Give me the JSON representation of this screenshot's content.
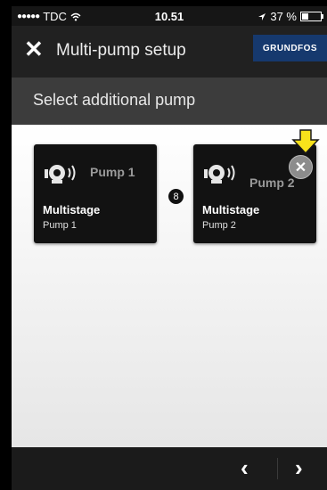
{
  "status": {
    "carrier": "TDC",
    "time": "10.51",
    "battery": "37 %"
  },
  "header": {
    "close_glyph": "✕",
    "title": "Multi-pump setup",
    "logo": "GRUNDFOS"
  },
  "subheader": {
    "text": "Select additional pump"
  },
  "pumps": [
    {
      "label": "Pump 1",
      "name": "Multistage",
      "sub": "Pump 1"
    },
    {
      "label": "Pump 2",
      "name": "Multistage",
      "sub": "Pump 2"
    }
  ],
  "link_glyph": "8",
  "remove_glyph": "✕",
  "footer": {
    "prev_glyph": "‹",
    "next_glyph": "›"
  },
  "colors": {
    "logo_bg": "#16396e",
    "arrow_fill": "#f8e21b"
  }
}
